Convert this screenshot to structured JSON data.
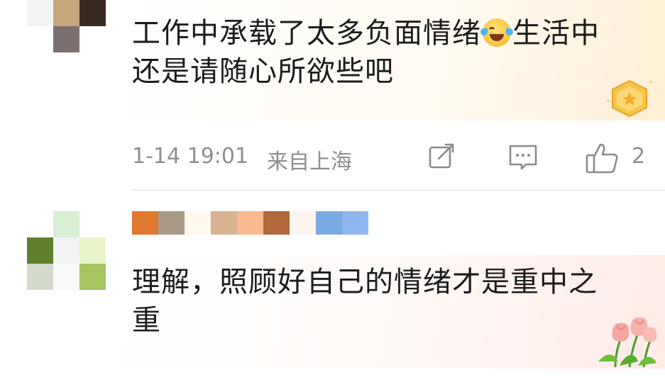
{
  "comments": [
    {
      "text_before_emoji": "工作中承载了太多负面情绪",
      "emoji_icon": "laughing-crying-face-icon",
      "text_after_emoji": "生活中还是请随心所欲些吧",
      "time": "1-14 19:01",
      "location": "来自上海",
      "like_count": "2",
      "avatar_colors": [
        "#f3f3f3",
        "#c7a57a",
        "#3b2a22",
        "#ffffff",
        "#7b6f70",
        "#ffffff"
      ],
      "decoration_icon": "gold-star-badge-icon"
    },
    {
      "nickname_colors": [
        "#e0772f",
        "#a99a86",
        "#fff8ee",
        "#d7b48f",
        "#fcb98f",
        "#b2683a",
        "#fff5ef",
        "#7aabe4",
        "#8fb6ee"
      ],
      "text": "理解，照顾好自己的情绪才是重中之重",
      "avatar_colors": [
        "#ffffff",
        "#d8efd3",
        "#ffffff",
        "#5e7f2b",
        "#f3f3f3",
        "#e9f4c9",
        "#d3d9cb",
        "#f9f9f9",
        "#a4c560"
      ],
      "decoration_icon": "tulip-bouquet-icon"
    }
  ],
  "icons": {
    "share": "share-icon",
    "comment": "comment-icon",
    "like": "thumbs-up-icon"
  }
}
